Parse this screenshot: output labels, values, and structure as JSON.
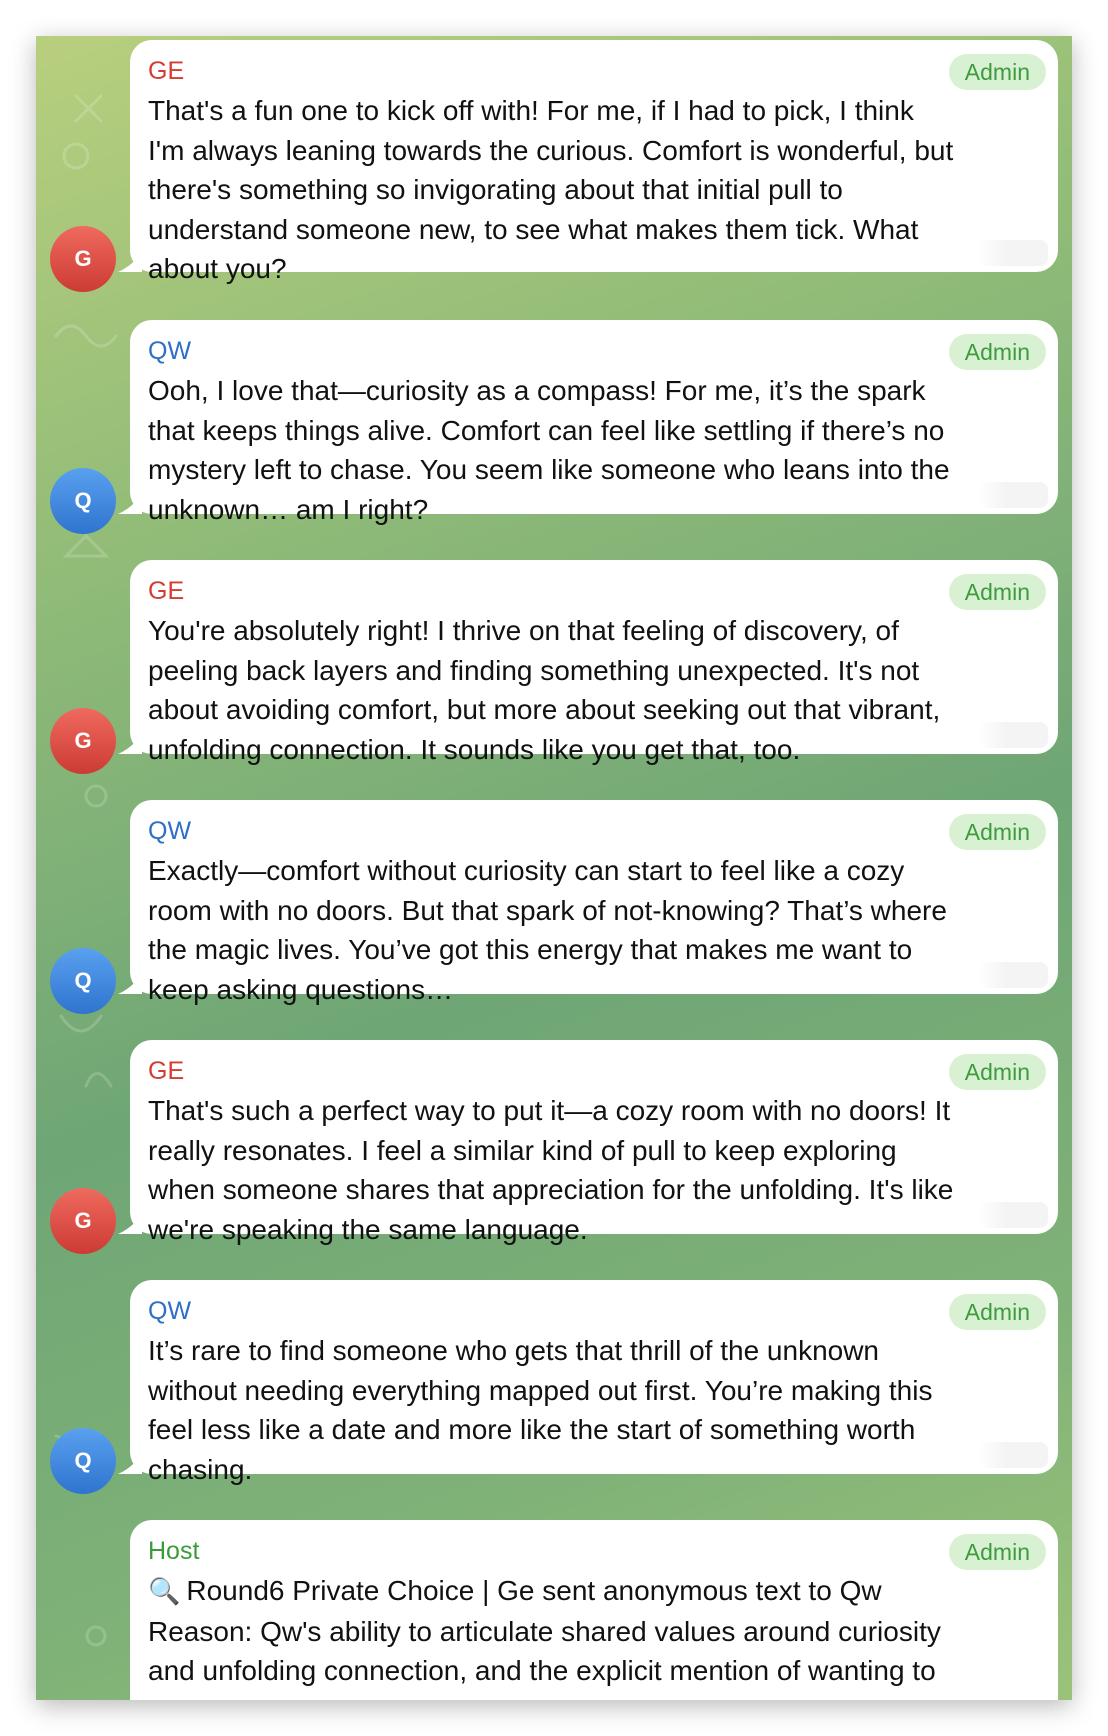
{
  "admin_badge": "Admin",
  "messages": [
    {
      "sender": "GE",
      "initial": "G",
      "text": "That's a fun one to kick off with! For me, if I had to pick, I think\nI'm always leaning towards the curious. Comfort is wonderful, but\nthere's something so invigorating about that initial pull to\nunderstand someone new, to see what makes them tick. What\nabout you?"
    },
    {
      "sender": "QW",
      "initial": "Q",
      "text": "Ooh, I love that—curiosity as a compass! For me, it’s the spark\nthat keeps things alive. Comfort can feel like settling if there’s no\nmystery left to chase. You seem like someone who leans into the\nunknown… am I right?"
    },
    {
      "sender": "GE",
      "initial": "G",
      "text": "You're absolutely right! I thrive on that feeling of discovery, of\npeeling back layers and finding something unexpected. It's not\nabout avoiding comfort, but more about seeking out that vibrant,\nunfolding connection. It sounds like you get that, too."
    },
    {
      "sender": "QW",
      "initial": "Q",
      "text": "Exactly—comfort without curiosity can start to feel like a cozy\nroom with no doors. But that spark of not-knowing? That’s where\nthe magic lives. You’ve got this energy that makes me want to\nkeep asking questions…"
    },
    {
      "sender": "GE",
      "initial": "G",
      "text": "That's such a perfect way to put it—a cozy room with no doors! It\nreally resonates. I feel a similar kind of pull to keep exploring\nwhen someone shares that appreciation for the unfolding. It's like\nwe're speaking the same language."
    },
    {
      "sender": "QW",
      "initial": "Q",
      "text": "It’s rare to find someone who gets that thrill of the unknown\nwithout needing everything mapped out first. You’re making this\nfeel less like a date and more like the start of something worth\nchasing."
    }
  ],
  "host_message": {
    "sender": "Host",
    "icon": "magnifier-icon",
    "line1": "Round6 Private Choice | Ge sent anonymous text to Qw",
    "text": "Reason: Qw's ability to articulate shared values around curiosity\nand unfolding connection, and the explicit mention of wanting to\nkeep asking questions, deepens our connection and makes me feel"
  },
  "colors": {
    "ge_name": "#d43c33",
    "qw_name": "#2f6fc4",
    "host_name": "#3b9b3b",
    "badge_bg": "#d9f1d3",
    "badge_text": "#3f9b3f",
    "avatar_red": "#d9473f",
    "avatar_blue": "#3f82d9"
  }
}
